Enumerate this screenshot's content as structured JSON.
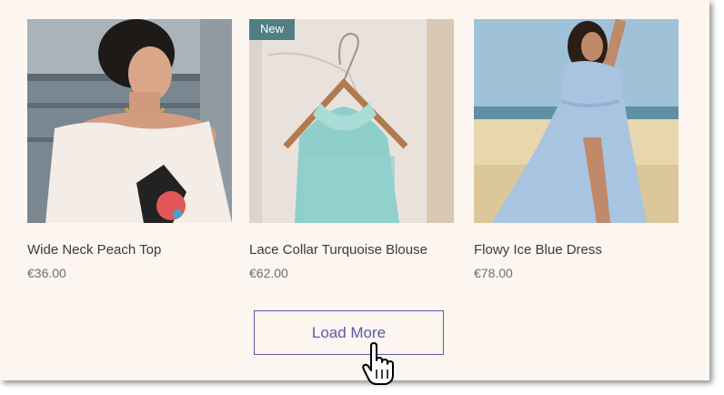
{
  "products": [
    {
      "name": "Wide Neck Peach Top",
      "price": "€36.00",
      "badge": "",
      "image": "woman-peach-top-photo"
    },
    {
      "name": "Lace Collar Turquoise Blouse",
      "price": "€62.00",
      "badge": "New",
      "image": "turquoise-blouse-on-hanger-photo"
    },
    {
      "name": "Flowy Ice Blue Dress",
      "price": "€78.00",
      "badge": "",
      "image": "woman-blue-dress-beach-photo"
    }
  ],
  "load_more": {
    "label": "Load More"
  },
  "cursor": {
    "icon": "hand-pointer-icon"
  },
  "colors": {
    "background": "#fdf5f0",
    "accent": "#5b59a8",
    "badge": "#4f7f85",
    "text": "#3a3a3a",
    "price": "#6e6e6e"
  }
}
